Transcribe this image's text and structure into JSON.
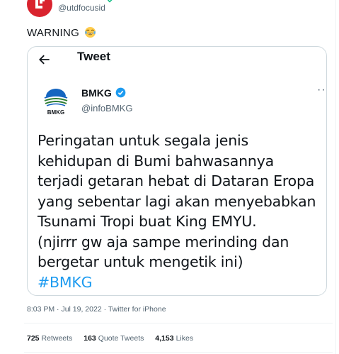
{
  "author": {
    "handle": "@utdfocusid"
  },
  "tweet": {
    "text": "WARNING",
    "emoji_icon": "face-with-tears-of-joy-icon"
  },
  "quoted": {
    "header_title": "Tweet",
    "name": "BMKG",
    "handle": "@infoBMKG",
    "logo_text": "BMKG",
    "body_lines": [
      "Peringatan untuk segala jenis",
      "kehidupan di Bumi bahwasannya",
      "terjadi getaran hebat di Dataran Eropa",
      "yang sebentar lagi akan menyebabkan",
      "Tsunami Tropi buat King EMYU.",
      "(njirrr gw aja sampe merinding dan",
      "bergetar untuk mengetik ini)"
    ],
    "hashtag": "#BMKG"
  },
  "meta": {
    "time": "8:03 PM",
    "date": "Jul 19, 2022",
    "source": "Twitter for iPhone"
  },
  "stats": {
    "retweets_count": "725",
    "retweets_label": "Retweets",
    "quotes_count": "163",
    "quotes_label": "Quote Tweets",
    "likes_count": "4,153",
    "likes_label": "Likes"
  },
  "colors": {
    "accent": "#1d9bf0",
    "avatar_red": "#d9232e",
    "text": "#0f1419",
    "secondary": "#536471"
  }
}
